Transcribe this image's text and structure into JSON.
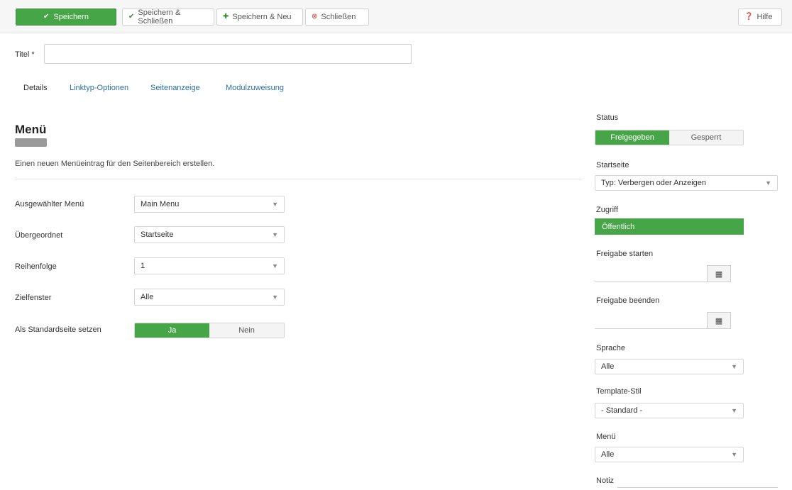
{
  "toolbar": {
    "save_label": "Speichern",
    "save_close_label": "Speichern & Schließen",
    "save_new_label": "Speichern & Neu",
    "close_label": "Schließen",
    "help_label": "Hilfe"
  },
  "title_field": {
    "label": "Titel *",
    "value": ""
  },
  "tabs": [
    {
      "label": "Details"
    },
    {
      "label": "Linktyp-Optionen"
    },
    {
      "label": "Seitenanzeige"
    },
    {
      "label": "Modulzuweisung"
    }
  ],
  "menu": {
    "heading": "Menü",
    "description": "Einen neuen Menüeintrag für den Seitenbereich erstellen."
  },
  "form": {
    "fields": [
      {
        "label": "Ausgewählter Menü",
        "value": "Main Menu"
      },
      {
        "label": "Übergeordnet",
        "value": "Startseite"
      },
      {
        "label": "Reihenfolge",
        "value": "1"
      },
      {
        "label": "Zielfenster",
        "value": "Alle"
      }
    ],
    "toggle_label": "Als Standardseite setzen",
    "toggle_on": "Ja",
    "toggle_off": "Nein"
  },
  "sidebar": {
    "status": {
      "label": "Status",
      "on": "Freigegeben",
      "off": "Gesperrt"
    },
    "start_page": {
      "label": "Startseite",
      "value": "Typ: Verbergen oder Anzeigen"
    },
    "access_label": "Zugriff",
    "access_value": "Öffentlich",
    "publish_up_label": "Freigabe starten",
    "publish_down_label": "Freigabe beenden",
    "language_label": "Sprache",
    "language_value": "Alle",
    "template_label": "Template-Stil",
    "template_value": "- Standard -",
    "menu_label": "Menü",
    "menu_value": "Alle",
    "notes_label": "Notiz"
  },
  "colors": {
    "accent": "#46a546",
    "link": "#2a6fa8"
  }
}
